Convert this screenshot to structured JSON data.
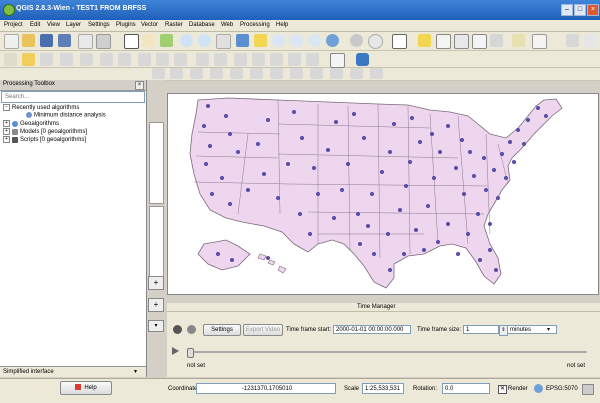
{
  "window": {
    "title": "QGIS 2.8.3-Wien - TEST1 FROM BRFSS"
  },
  "menubar": [
    "Project",
    "Edit",
    "View",
    "Layer",
    "Settings",
    "Plugins",
    "Vector",
    "Raster",
    "Database",
    "Web",
    "Processing",
    "Help"
  ],
  "processing_toolbox": {
    "title": "Processing Toolbox",
    "search_placeholder": "Search...",
    "tree": {
      "recent": "Recently used algorithms",
      "recent_child": "Minimum distance analysis",
      "geo": "Geoalgorithms",
      "models": "Models [0 geoalgorithms]",
      "scripts": "Scripts [0 geoalgorithms]"
    },
    "mode": "Simplified interface"
  },
  "help_button": "Help",
  "time_manager": {
    "title": "Time Manager",
    "settings_label": "Settings",
    "export_label": "Export Video",
    "start_label": "Time frame start:",
    "start_value": "2000-01-01 00:00:00.000",
    "size_label": "Time frame size:",
    "size_value": "1",
    "unit_value": "minutes",
    "left_status": "not set",
    "right_status": "not set"
  },
  "statusbar": {
    "coordinate_label": "Coordinate:",
    "coordinate_value": "-1231370,1705010",
    "scale_label": "Scale",
    "scale_value": "1:25,533,531",
    "rotation_label": "Rotation:",
    "rotation_value": "0.0",
    "render_label": "Render",
    "crs_label": "EPSG:5070"
  }
}
